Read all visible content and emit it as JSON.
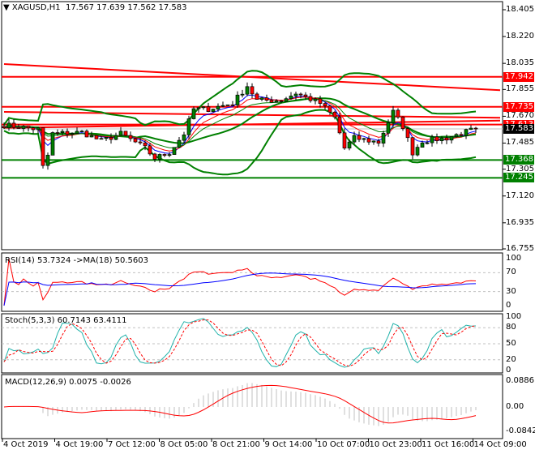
{
  "header": {
    "symbol": "XAGUSD,H1",
    "open": "17.567",
    "high": "17.639",
    "low": "17.562",
    "close": "17.583"
  },
  "colors": {
    "bull": "#008000",
    "bear": "#ff0000",
    "resistance": "#ff0000",
    "support": "#008000",
    "bands": "#008000",
    "ma_fast": "#0000ff",
    "ma_mid": "#ff0000",
    "ma_slow": "#008000",
    "rsi": "#ff0000",
    "rsi_ma": "#0000ff",
    "stoch_main": "#20b2aa",
    "stoch_signal": "#ff0000",
    "macd_hist": "#c0c0c0",
    "macd_signal": "#ff0000"
  },
  "price_axis": [
    "18.405",
    "18.220",
    "18.035",
    "17.855",
    "17.670",
    "17.485",
    "17.305",
    "17.120",
    "16.935",
    "16.755"
  ],
  "price_tags": [
    {
      "value": "17.942",
      "type": "resistance"
    },
    {
      "value": "17.735",
      "type": "resistance"
    },
    {
      "value": "17.613",
      "type": "resistance"
    },
    {
      "value": "17.583",
      "type": "current"
    },
    {
      "value": "17.368",
      "type": "support"
    },
    {
      "value": "17.245",
      "type": "support"
    }
  ],
  "time_axis": [
    "4 Oct 2019",
    "4 Oct 19:00",
    "7 Oct 12:00",
    "8 Oct 05:00",
    "8 Oct 21:00",
    "9 Oct 14:00",
    "10 Oct 07:00",
    "10 Oct 23:00",
    "11 Oct 16:00",
    "14 Oct 09:00"
  ],
  "rsi": {
    "label": "RSI(14) 53.7324  ->MA(18) 50.5603",
    "levels": [
      "100",
      "70",
      "30",
      "0"
    ]
  },
  "stoch": {
    "label": "Stoch(5,3,3) 60.7143 63.4111",
    "levels": [
      "100",
      "80",
      "50",
      "20",
      "0"
    ]
  },
  "macd": {
    "label": "MACD(12,26,9) 0.0075 -0.0026",
    "levels": [
      "0.0886",
      "0.00",
      "-0.0842"
    ]
  },
  "chart_data": {
    "type": "candlestick",
    "title": "XAGUSD,H1",
    "ylim": [
      16.755,
      18.405
    ],
    "bars": 98,
    "close_keypoints": [
      [
        0,
        17.61
      ],
      [
        7,
        17.58
      ],
      [
        8,
        17.32
      ],
      [
        9,
        17.4
      ],
      [
        10,
        17.55
      ],
      [
        16,
        17.56
      ],
      [
        20,
        17.5
      ],
      [
        24,
        17.55
      ],
      [
        29,
        17.45
      ],
      [
        31,
        17.38
      ],
      [
        34,
        17.42
      ],
      [
        37,
        17.55
      ],
      [
        39,
        17.72
      ],
      [
        42,
        17.72
      ],
      [
        47,
        17.76
      ],
      [
        50,
        17.88
      ],
      [
        52,
        17.78
      ],
      [
        57,
        17.78
      ],
      [
        60,
        17.83
      ],
      [
        65,
        17.76
      ],
      [
        68,
        17.66
      ],
      [
        70,
        17.45
      ],
      [
        72,
        17.52
      ],
      [
        77,
        17.49
      ],
      [
        80,
        17.7
      ],
      [
        82,
        17.6
      ],
      [
        84,
        17.42
      ],
      [
        86,
        17.5
      ],
      [
        91,
        17.52
      ],
      [
        97,
        17.583
      ]
    ],
    "horizontal_levels": [
      17.942,
      17.735,
      17.613,
      17.368,
      17.245
    ],
    "trendlines": [
      [
        [
          0,
          18.03
        ],
        [
          102,
          17.85
        ]
      ],
      [
        [
          0,
          17.7
        ],
        [
          102,
          17.66
        ]
      ],
      [
        [
          0,
          17.59
        ],
        [
          102,
          17.64
        ]
      ]
    ],
    "current_price": 17.583,
    "indicators": [
      "Bollinger Bands",
      "Moving Averages",
      "RSI(14)",
      "Stochastic(5,3,3)",
      "MACD(12,26,9)"
    ]
  }
}
